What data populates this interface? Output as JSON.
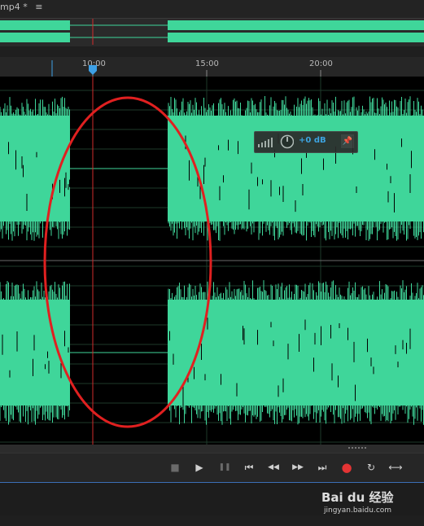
{
  "tab": {
    "title": "mp4 *",
    "menu_icon": "hamburger-menu-icon"
  },
  "ruler": {
    "labels": [
      "10:00",
      "15:00",
      "20:00"
    ]
  },
  "volume_hud": {
    "value": "+0 dB",
    "icons": [
      "level-bars-icon",
      "volume-knob-icon",
      "pin-icon"
    ]
  },
  "transport": {
    "buttons": [
      {
        "name": "stop-button",
        "glyph": "■"
      },
      {
        "name": "play-button",
        "glyph": "▶"
      },
      {
        "name": "pause-button",
        "glyph": "❚❚"
      },
      {
        "name": "go-to-start-button",
        "glyph": "⏮"
      },
      {
        "name": "rewind-button",
        "glyph": "◀◀"
      },
      {
        "name": "fast-forward-button",
        "glyph": "▶▶"
      },
      {
        "name": "go-to-end-button",
        "glyph": "⏭"
      },
      {
        "name": "record-button",
        "glyph": "●"
      },
      {
        "name": "loop-button",
        "glyph": "↻"
      },
      {
        "name": "skip-selection-button",
        "glyph": "⟷"
      }
    ]
  },
  "watermark": {
    "brand": "Bai du 经验",
    "url": "jingyan.baidu.com"
  },
  "colors": {
    "waveform": "#3fd69a",
    "playhead": "#d12c2c",
    "annotation": "#e02020",
    "accent": "#3da0e6"
  }
}
